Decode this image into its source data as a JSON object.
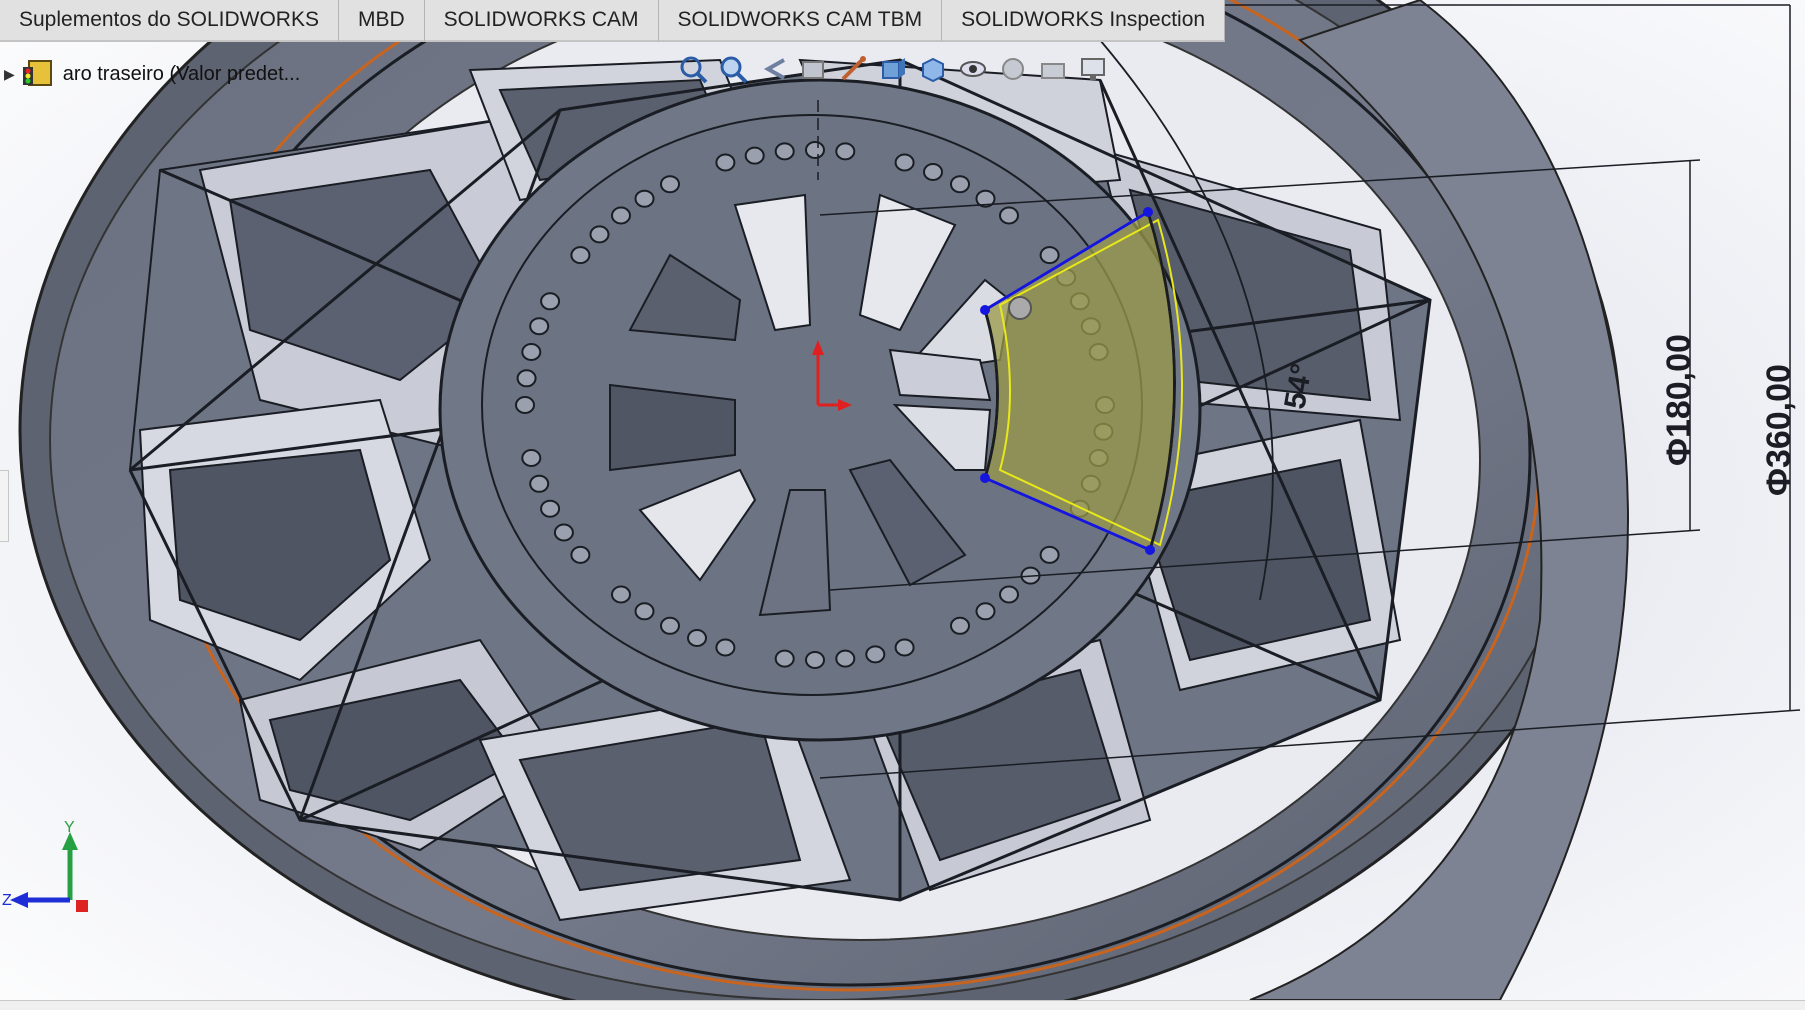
{
  "tabs": [
    {
      "label": "Suplementos do SOLIDWORKS"
    },
    {
      "label": "MBD"
    },
    {
      "label": "SOLIDWORKS CAM"
    },
    {
      "label": "SOLIDWORKS CAM TBM"
    },
    {
      "label": "SOLIDWORKS Inspection"
    }
  ],
  "feature_tree": {
    "label": "aro traseiro  (Valor predet..."
  },
  "toolbar": {
    "icons": [
      "zoom-to-fit-icon",
      "zoom-to-area-icon",
      "previous-view-icon",
      "section-view-icon",
      "dynamic-annotation-icon",
      "view-orientation-icon",
      "display-style-icon",
      "hide-show-items-icon",
      "edit-appearance-icon",
      "apply-scene-icon",
      "view-settings-icon"
    ]
  },
  "dimensions": {
    "d_inner": "Φ180,00",
    "d_outer": "Φ360,00",
    "angle": "54°"
  },
  "triad": {
    "y_label": "Y",
    "z_label": "Z"
  },
  "colors": {
    "part_face": "#6e7584",
    "part_dark": "#4c5260",
    "edge": "#1a1d24",
    "selection": "#e8e81a",
    "sketch_blue": "#1515e0",
    "orange_edge": "#c8641e"
  }
}
